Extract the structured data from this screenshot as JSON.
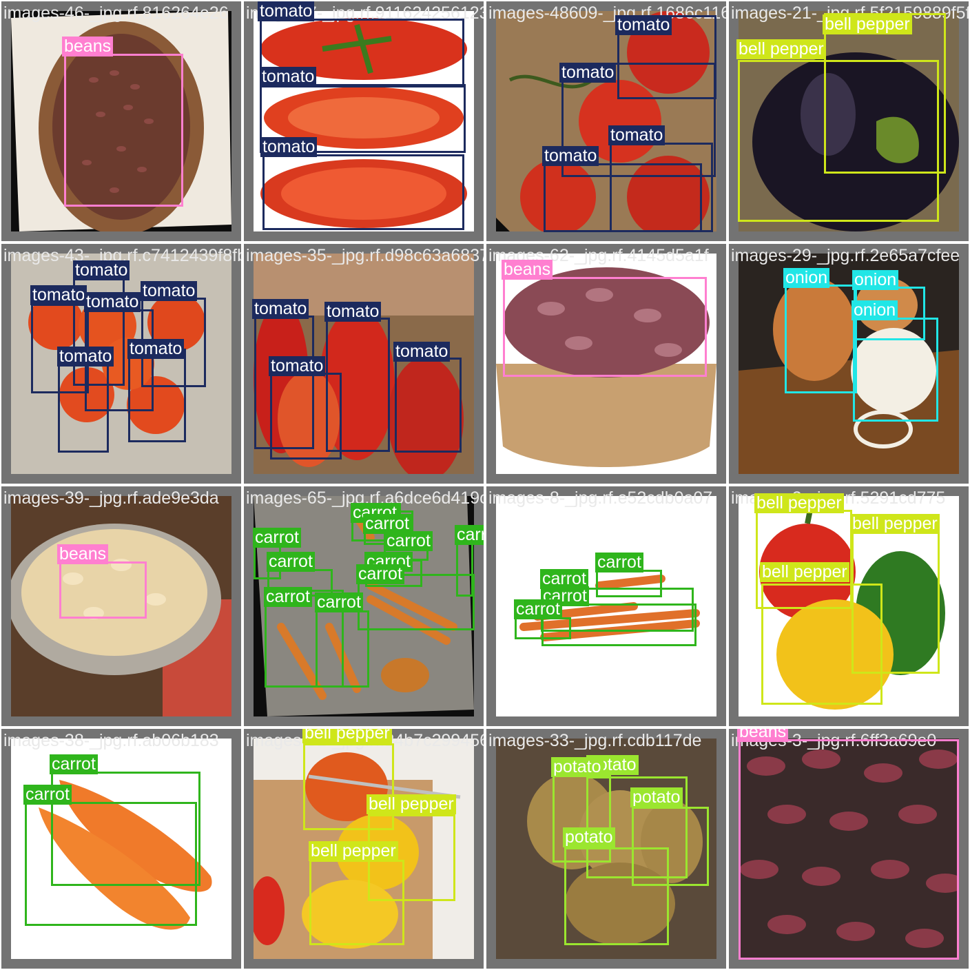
{
  "tiles": [
    {
      "filename": "images-46-_jpg.rf.816264e26",
      "objects": [
        {
          "label": "beans"
        }
      ]
    },
    {
      "filename": "images-7-_jpg.rf.9116242561231",
      "objects": [
        {
          "label": "tomato"
        },
        {
          "label": "tomato"
        },
        {
          "label": "tomato"
        }
      ]
    },
    {
      "filename": "images-48609-_jpg.rf.1686c1160d",
      "objects": [
        {
          "label": "tomato"
        },
        {
          "label": "tomato"
        },
        {
          "label": "tomato"
        },
        {
          "label": "tomato"
        }
      ]
    },
    {
      "filename": "images-21-_jpg.rf.5f2159889f5fcbd5cd",
      "objects": [
        {
          "label": "bell pepper"
        },
        {
          "label": "bell pepper"
        }
      ]
    },
    {
      "filename": "images-43-_jpg.rf.c7412439f8fbc2059d85",
      "objects": [
        {
          "label": "tomato"
        },
        {
          "label": "tomato"
        },
        {
          "label": "tomato"
        },
        {
          "label": "tomato"
        },
        {
          "label": "tomato"
        },
        {
          "label": "tomato"
        }
      ]
    },
    {
      "filename": "images-35-_jpg.rf.d98c63a6837",
      "objects": [
        {
          "label": "tomato"
        },
        {
          "label": "tomato"
        },
        {
          "label": "tomato"
        },
        {
          "label": "tomato"
        }
      ]
    },
    {
      "filename": "images-62-_jpg.rf.4145d5a1f",
      "objects": [
        {
          "label": "beans"
        }
      ]
    },
    {
      "filename": "images-29-_jpg.rf.2e65a7cfee",
      "objects": [
        {
          "label": "onion"
        },
        {
          "label": "onion"
        },
        {
          "label": "onion"
        }
      ]
    },
    {
      "filename": "images-39-_jpg.rf.ade9e3da",
      "objects": [
        {
          "label": "beans"
        }
      ]
    },
    {
      "filename": "images-65-_jpg.rf.a6dce6d419c",
      "objects": [
        {
          "label": "carrot"
        },
        {
          "label": "carrot"
        },
        {
          "label": "carrot"
        },
        {
          "label": "carrot"
        },
        {
          "label": "carrot"
        },
        {
          "label": "carrot"
        },
        {
          "label": "carrot"
        },
        {
          "label": "carrot"
        },
        {
          "label": "carrot"
        },
        {
          "label": "carrot"
        }
      ]
    },
    {
      "filename": "images-8-_jpg.rf.e52cdb0a07",
      "objects": [
        {
          "label": "carrot"
        },
        {
          "label": "carrot"
        },
        {
          "label": "carrot"
        },
        {
          "label": "carrot"
        }
      ]
    },
    {
      "filename": "images-3-_jpg.rf.5291cd775",
      "objects": [
        {
          "label": "bell pepper"
        },
        {
          "label": "bell pepper"
        },
        {
          "label": "bell pepper"
        }
      ]
    },
    {
      "filename": "images-38-_jpg.rf.ab06b183",
      "objects": [
        {
          "label": "carrot"
        },
        {
          "label": "carrot"
        }
      ]
    },
    {
      "filename": "images-81-_jpg.rf.24b7c299456",
      "objects": [
        {
          "label": "bell pepper"
        },
        {
          "label": "bell pepper"
        },
        {
          "label": "bell pepper"
        }
      ]
    },
    {
      "filename": "images-33-_jpg.rf.cdb117de",
      "objects": [
        {
          "label": "potato"
        },
        {
          "label": "potato"
        },
        {
          "label": "potato"
        },
        {
          "label": "potato"
        }
      ]
    },
    {
      "filename": "images-3-_jpg.rf.6ff3a69e0",
      "objects": [
        {
          "label": "beans"
        }
      ]
    }
  ],
  "class_colors": {
    "beans": "#ff7fd0",
    "tomato": "#1c2a5e",
    "bell pepper": "#cfe61a",
    "onion": "#21e6e6",
    "carrot": "#2fb51c",
    "potato": "#9be62f"
  }
}
